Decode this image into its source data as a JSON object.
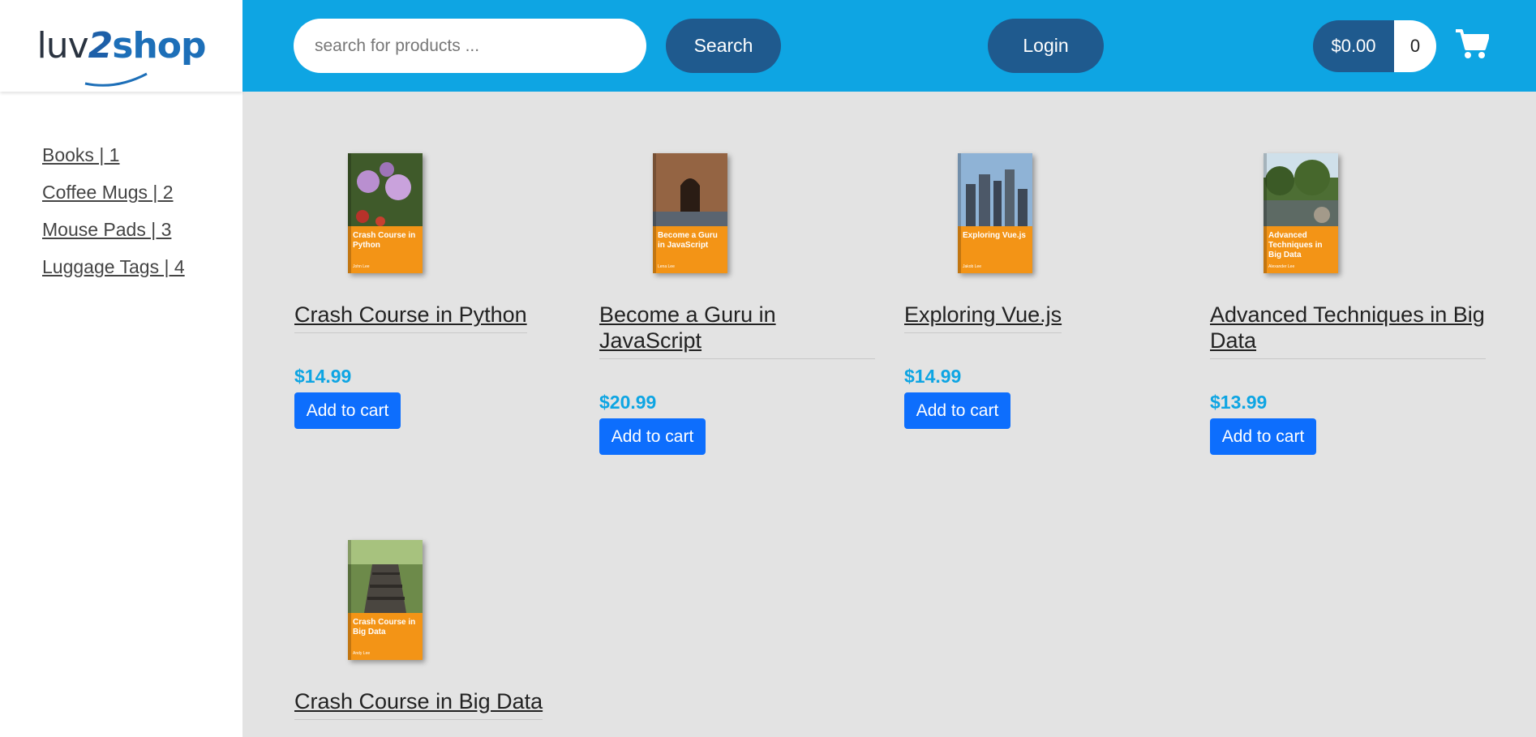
{
  "brand": {
    "logo_text_part1": "luv",
    "logo_text_part2": "2",
    "logo_text_part3": "shop"
  },
  "header": {
    "search_placeholder": "search for products ...",
    "search_button": "Search",
    "login_button": "Login",
    "cart_total": "$0.00",
    "cart_quantity": "0"
  },
  "sidebar": {
    "categories": [
      {
        "label": "Books | 1"
      },
      {
        "label": "Coffee Mugs | 2"
      },
      {
        "label": "Mouse Pads | 3"
      },
      {
        "label": "Luggage Tags | 4"
      }
    ]
  },
  "products": [
    {
      "title": "Crash Course in Python",
      "price": "$14.99",
      "button": "Add to cart",
      "cover_title": "Crash Course in Python",
      "cover_author": "John Lee"
    },
    {
      "title": "Become a Guru in JavaScript",
      "price": "$20.99",
      "button": "Add to cart",
      "cover_title": "Become a Guru in JavaScript",
      "cover_author": "Lena Lee"
    },
    {
      "title": "Exploring Vue.js",
      "price": "$14.99",
      "button": "Add to cart",
      "cover_title": "Exploring Vue.js",
      "cover_author": "Jakob Lee"
    },
    {
      "title": "Advanced Techniques in Big Data",
      "price": "$13.99",
      "button": "Add to cart",
      "cover_title": "Advanced Techniques in Big Data",
      "cover_author": "Alexander Lee"
    },
    {
      "title": "Crash Course in Big Data",
      "price": "",
      "button": "",
      "cover_title": "Crash Course in Big Data",
      "cover_author": "Andy Lee"
    }
  ],
  "colors": {
    "header_bg": "#0ea5e3",
    "pill_button": "#1f5a8e",
    "price": "#0ea5e3",
    "add_to_cart": "#0d6efd",
    "content_bg": "#e3e3e3",
    "cover_band": "#f39416"
  },
  "icons": {
    "cart": "shopping-cart-icon"
  }
}
